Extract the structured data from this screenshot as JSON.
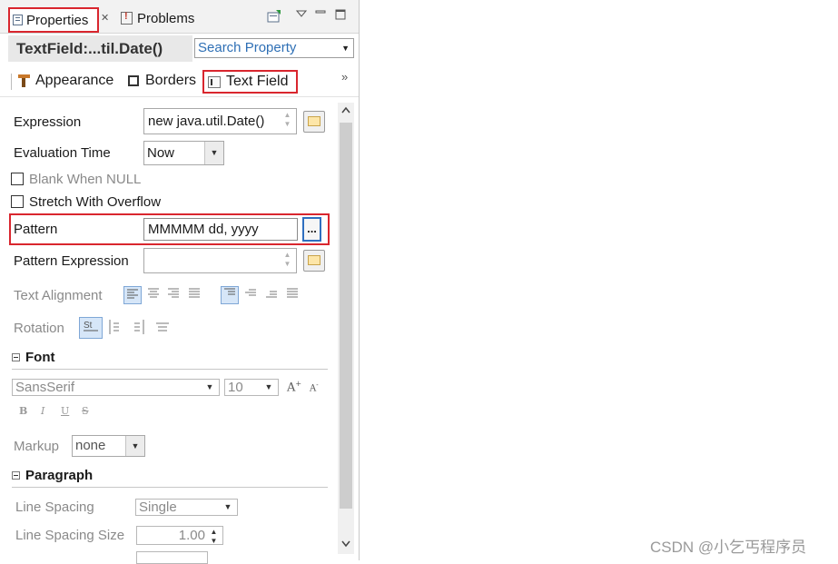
{
  "tabs": {
    "properties": "Properties",
    "problems": "Problems"
  },
  "header": {
    "title": "TextField:...til.Date()",
    "search_placeholder": "Search Property"
  },
  "section_tabs": {
    "appearance": "Appearance",
    "borders": "Borders",
    "text_field": "Text Field"
  },
  "form": {
    "expression_label": "Expression",
    "expression_value": "new java.util.Date()",
    "evaluation_time_label": "Evaluation Time",
    "evaluation_time_value": "Now",
    "blank_when_null": "Blank When NULL",
    "stretch_with_overflow": "Stretch With Overflow",
    "pattern_label": "Pattern",
    "pattern_value": "MMMMM dd, yyyy",
    "pattern_button": "...",
    "pattern_expression_label": "Pattern Expression",
    "text_alignment_label": "Text Alignment",
    "rotation_label": "Rotation"
  },
  "font": {
    "heading": "Font",
    "family": "SansSerif",
    "size": "10",
    "grow": "A",
    "shrink": "A",
    "bold": "B",
    "italic": "I",
    "underline": "U",
    "strike": "S",
    "markup_label": "Markup",
    "markup_value": "none"
  },
  "paragraph": {
    "heading": "Paragraph",
    "line_spacing_label": "Line Spacing",
    "line_spacing_value": "Single",
    "line_spacing_size_label": "Line Spacing Size",
    "line_spacing_size_value": "1.00"
  },
  "icons": [
    "properties-icon",
    "problems-icon",
    "close-icon",
    "new-view-icon",
    "view-menu-icon",
    "minimize-icon",
    "maximize-icon",
    "appearance-icon",
    "borders-icon",
    "text-field-icon",
    "more-tabs-icon",
    "expression-editor-icon",
    "rotation-icons",
    "scroll-up-icon",
    "scroll-down-icon"
  ],
  "watermark": "CSDN @小乞丐程序员"
}
